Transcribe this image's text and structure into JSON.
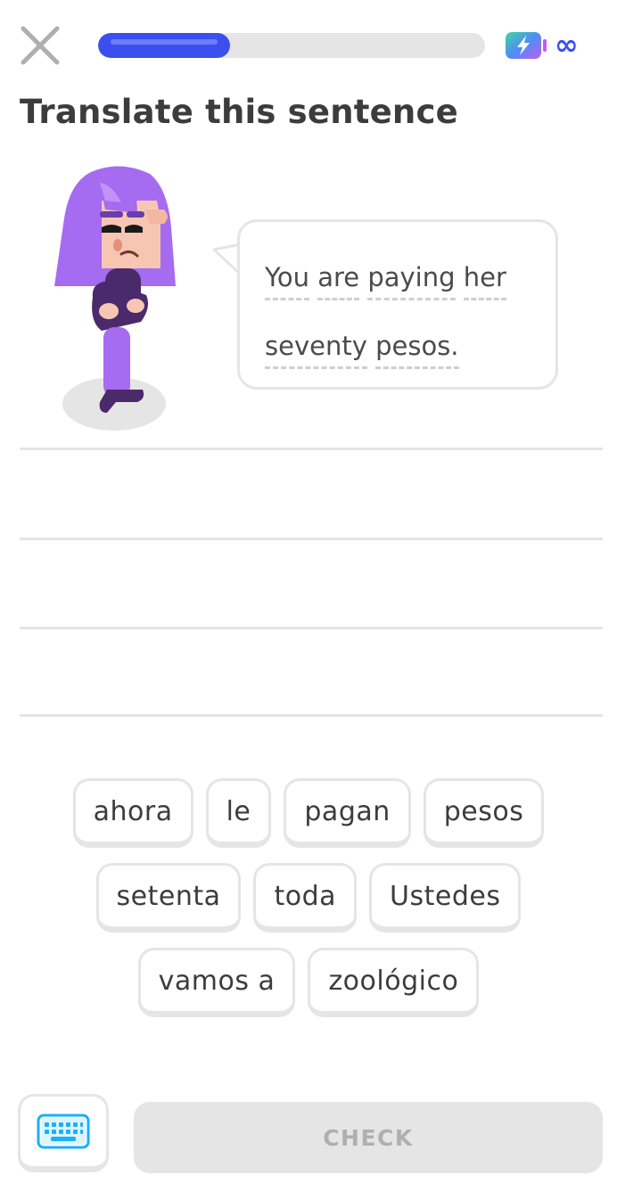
{
  "header": {
    "progress_percent": 34,
    "energy_value": "∞"
  },
  "title": "Translate this sentence",
  "prompt": {
    "words": [
      "You",
      "are",
      "paying",
      "her",
      "seventy",
      "pesos."
    ]
  },
  "word_bank": {
    "rows": [
      [
        "ahora",
        "le",
        "pagan",
        "pesos"
      ],
      [
        "setenta",
        "toda",
        "Ustedes"
      ],
      [
        "vamos a",
        "zoológico"
      ]
    ]
  },
  "footer": {
    "check_label": "CHECK"
  },
  "colors": {
    "progress": "#3b4ff0",
    "tile_border": "#e5e5e5",
    "check_disabled_bg": "#e5e5e5",
    "check_disabled_text": "#afafaf",
    "character_hair": "#a56bf0",
    "character_shirt": "#4b2a6b"
  },
  "icons": {
    "close": "close-icon",
    "energy": "energy-battery-icon",
    "keyboard": "keyboard-icon"
  }
}
